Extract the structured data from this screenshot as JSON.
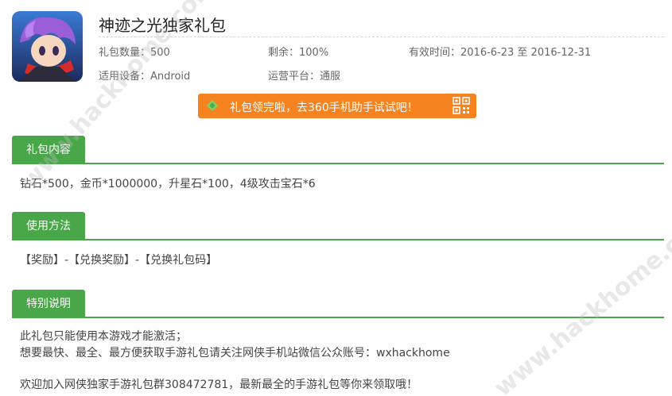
{
  "gift": {
    "title": "神迹之光独家礼包",
    "avatar_icon": "game-character-icon",
    "info": {
      "count_label": "礼包数量：",
      "count_value": "500",
      "remaining_label": "剩余：",
      "remaining_value": "100%",
      "validity_label": "有效时间：",
      "validity_value": "2016-6-23 至 2016-12-31",
      "device_label": "适用设备：",
      "device_value": "Android",
      "platform_label": "运营平台：",
      "platform_value": "通服"
    },
    "notice": {
      "text": "礼包领完啦，去360手机助手试试吧！",
      "icon": "360-assistant-icon",
      "qr_icon": "qr-code-icon",
      "color": "#f5831f"
    }
  },
  "sections": {
    "content": {
      "label": "礼包内容",
      "body": "钻石*500，金币*1000000，升星石*100，4级攻击宝石*6"
    },
    "usage": {
      "label": "使用方法",
      "body": "【奖励】-【兑换奖励】-【兑换礼包码】"
    },
    "notes": {
      "label": "特别说明",
      "line1": "此礼包只能使用本游戏才能激活；",
      "line2": "想要最快、最全、最方便获取手游礼包请关注网侠手机站微信公众账号：wxhackhome",
      "line3": "欢迎加入网侠独家手游礼包群308472781，最新最全的手游礼包等你来领取哦！"
    }
  },
  "watermark": "www.hackhome.com",
  "colors": {
    "accent": "#49a749",
    "notice": "#f5831f"
  }
}
